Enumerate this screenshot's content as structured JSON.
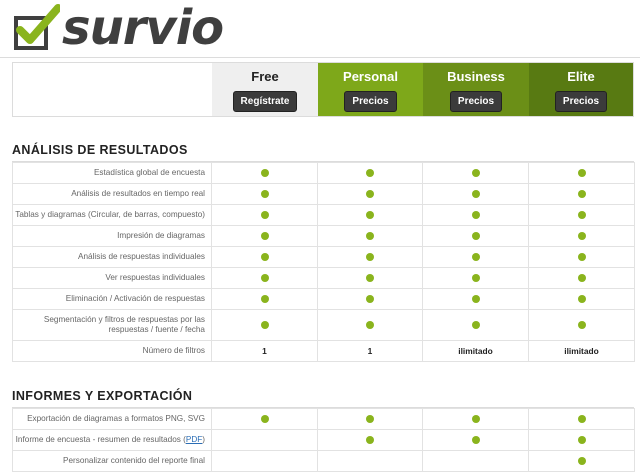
{
  "brand": {
    "name": "survio"
  },
  "plans": [
    {
      "name": "Free",
      "button": "Regístrate"
    },
    {
      "name": "Personal",
      "button": "Precios"
    },
    {
      "name": "Business",
      "button": "Precios"
    },
    {
      "name": "Elite",
      "button": "Precios"
    }
  ],
  "section1": {
    "title": "ANÁLISIS DE RESULTADOS",
    "rows": [
      {
        "label": "Estadística global de encuesta",
        "cells": [
          "dot",
          "dot",
          "dot",
          "dot"
        ]
      },
      {
        "label": "Análisis de resultados en tiempo real",
        "cells": [
          "dot",
          "dot",
          "dot",
          "dot"
        ]
      },
      {
        "label": "Tablas y diagramas (Circular, de barras, compuesto)",
        "cells": [
          "dot",
          "dot",
          "dot",
          "dot"
        ]
      },
      {
        "label": "Impresión de diagramas",
        "cells": [
          "dot",
          "dot",
          "dot",
          "dot"
        ]
      },
      {
        "label": "Análisis de respuestas individuales",
        "cells": [
          "dot",
          "dot",
          "dot",
          "dot"
        ]
      },
      {
        "label": "Ver respuestas individuales",
        "cells": [
          "dot",
          "dot",
          "dot",
          "dot"
        ]
      },
      {
        "label": "Eliminación / Activación de respuestas",
        "cells": [
          "dot",
          "dot",
          "dot",
          "dot"
        ]
      },
      {
        "label": "Segmentación y filtros de respuestas por las respuestas / fuente / fecha",
        "cells": [
          "dot",
          "dot",
          "dot",
          "dot"
        ]
      },
      {
        "label": "Número de filtros",
        "cells": [
          "1",
          "1",
          "ilimitado",
          "ilimitado"
        ]
      }
    ]
  },
  "section2": {
    "title": "INFORMES Y EXPORTACIÓN",
    "rows": [
      {
        "label": "Exportación de diagramas a formatos PNG, SVG",
        "cells": [
          "dot",
          "dot",
          "dot",
          "dot"
        ]
      },
      {
        "label": "Informe de encuesta - resumen de resultados",
        "link": "PDF",
        "cells": [
          "",
          "dot",
          "dot",
          "dot"
        ]
      },
      {
        "label": "Personalizar contenido del reporte final",
        "cells": [
          "",
          "",
          "",
          "dot"
        ]
      }
    ]
  },
  "colors": {
    "accent": "#8ab41d",
    "personal": "#7ea81a",
    "business": "#6b8f17",
    "elite": "#587a12"
  }
}
